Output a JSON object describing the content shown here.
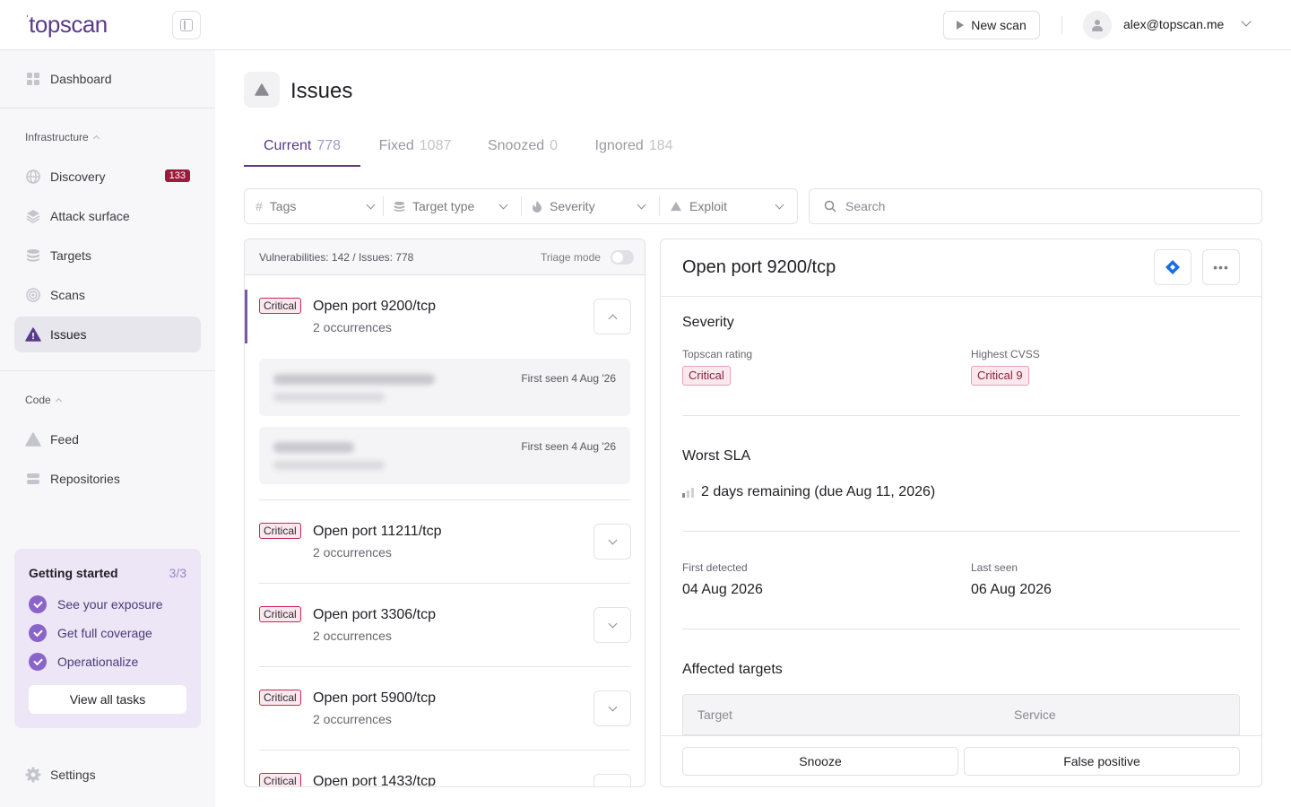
{
  "header": {
    "logo": "topscan",
    "new_scan_label": "New scan",
    "user_email": "alex@topscan.me"
  },
  "sidebar": {
    "dashboard": "Dashboard",
    "infra_label": "Infrastructure",
    "infra_items": [
      {
        "label": "Discovery",
        "badge": "133"
      },
      {
        "label": "Attack surface"
      },
      {
        "label": "Targets"
      },
      {
        "label": "Scans"
      },
      {
        "label": "Issues"
      }
    ],
    "code_label": "Code",
    "code_items": [
      {
        "label": "Feed"
      },
      {
        "label": "Repositories"
      }
    ],
    "getting_started": {
      "title": "Getting started",
      "count": "3/3",
      "tasks": [
        "See your exposure",
        "Get full coverage",
        "Operationalize"
      ],
      "button": "View all tasks"
    },
    "settings": "Settings"
  },
  "page": {
    "title": "Issues",
    "tabs": [
      {
        "label": "Current",
        "count": "778"
      },
      {
        "label": "Fixed",
        "count": "1087"
      },
      {
        "label": "Snoozed",
        "count": "0"
      },
      {
        "label": "Ignored",
        "count": "184"
      }
    ],
    "filters": [
      "Tags",
      "Target type",
      "Severity",
      "Exploit"
    ],
    "search_placeholder": "Search"
  },
  "list": {
    "stats": "Vulnerabilities: 142 / Issues: 778",
    "triage_label": "Triage mode",
    "issues": [
      {
        "severity": "Critical",
        "title": "Open port 9200/tcp",
        "occurrences": "2 occurrences"
      },
      {
        "severity": "Critical",
        "title": "Open port 11211/tcp",
        "occurrences": "2 occurrences"
      },
      {
        "severity": "Critical",
        "title": "Open port 3306/tcp",
        "occurrences": "2 occurrences"
      },
      {
        "severity": "Critical",
        "title": "Open port 5900/tcp",
        "occurrences": "2 occurrences"
      },
      {
        "severity": "Critical",
        "title": "Open port 1433/tcp",
        "occurrences": ""
      }
    ],
    "occurrences": [
      {
        "first_seen": "First seen 4 Aug '26"
      },
      {
        "first_seen": "First seen 4 Aug '26"
      }
    ]
  },
  "detail": {
    "title": "Open port 9200/tcp",
    "severity_heading": "Severity",
    "topscan_rating_label": "Topscan rating",
    "topscan_rating_value": "Critical",
    "highest_cvss_label": "Highest CVSS",
    "highest_cvss_value": "Critical 9",
    "sla_heading": "Worst SLA",
    "sla_text": "2 days remaining (due Aug 11, 2026)",
    "first_detected_label": "First detected",
    "first_detected_value": "04 Aug 2026",
    "last_seen_label": "Last seen",
    "last_seen_value": "06 Aug 2026",
    "affected_heading": "Affected targets",
    "table_headers": [
      "Target",
      "Service"
    ],
    "snooze_label": "Snooze",
    "false_positive_label": "False positive"
  },
  "colors": {
    "brand": "#5b3a8c",
    "critical": "#c42a4e",
    "badge": "#9b1c3a"
  }
}
